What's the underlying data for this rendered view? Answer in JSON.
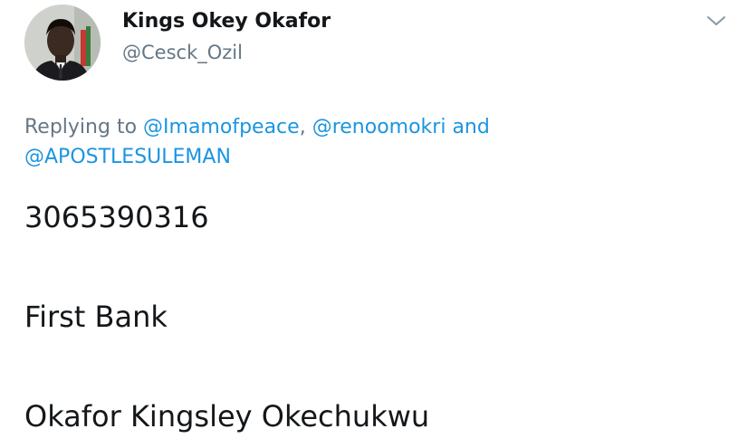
{
  "author": {
    "display_name": "Kings Okey Okafor",
    "handle": "@Cesck_Ozil"
  },
  "icons": {
    "menu": "chevron-down-icon",
    "avatar": "profile-photo"
  },
  "reply": {
    "prefix": "Replying to",
    "mentions": [
      "@Imamofpeace",
      "@renoomokri",
      "@APOSTLESULEMAN"
    ],
    "separator": ",",
    "conjunction": "and"
  },
  "body": {
    "lines": [
      "3065390316",
      "First Bank",
      "Okafor Kingsley Okechukwu"
    ]
  },
  "colors": {
    "name": "#14171a",
    "secondary": "#657786",
    "link": "#1b95e0",
    "background": "#ffffff"
  }
}
